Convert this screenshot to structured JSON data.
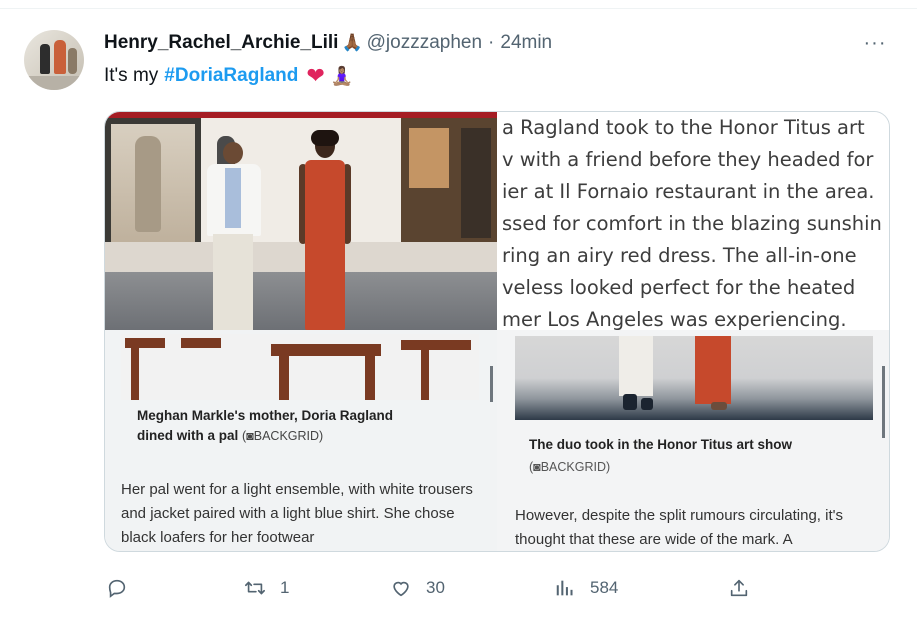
{
  "tweet": {
    "author_name": "Henry_Rachel_Archie_Lili",
    "author_emoji": "🙏🏾",
    "handle": "@jozzzaphen",
    "separator": "·",
    "time": "24min",
    "more_label": "···",
    "text_prefix": "It's my",
    "hashtag": "#DoriaRagland",
    "heart_emoji": "❤",
    "person_emoji": "🧘🏽‍♀️"
  },
  "media": {
    "article_lines": [
      "a Ragland took to the Honor Titus art",
      "v with a friend before they headed for",
      "ier at Il Fornaio restaurant in the area.",
      "ssed for comfort in the blazing sunshin",
      "ring an airy red dress. The all-in-one",
      "veless looked perfect for the heated",
      "mer Los Angeles was experiencing."
    ],
    "left_caption_line1": "Meghan Markle's mother, Doria Ragland",
    "left_caption_line2": "dined with a pal",
    "left_credit": "(◙BACKGRID)",
    "left_body": "Her pal went for a light ensemble, with white trousers and jacket paired with a light blue shirt. She chose black loafers for her footwear",
    "right_caption": "The duo took in the Honor Titus art show",
    "right_credit": "(◙BACKGRID)",
    "right_body": "However, despite the split rumours circulating, it's thought that these are wide of the mark. A"
  },
  "actions": {
    "reply_count": "",
    "retweet_count": "1",
    "like_count": "30",
    "views_count": "584"
  },
  "colors": {
    "accent": "#1d9bf0",
    "muted": "#536471",
    "heart": "#e0245e"
  },
  "icons": [
    "more-icon",
    "reply-icon",
    "retweet-icon",
    "like-icon",
    "views-icon",
    "share-icon"
  ]
}
